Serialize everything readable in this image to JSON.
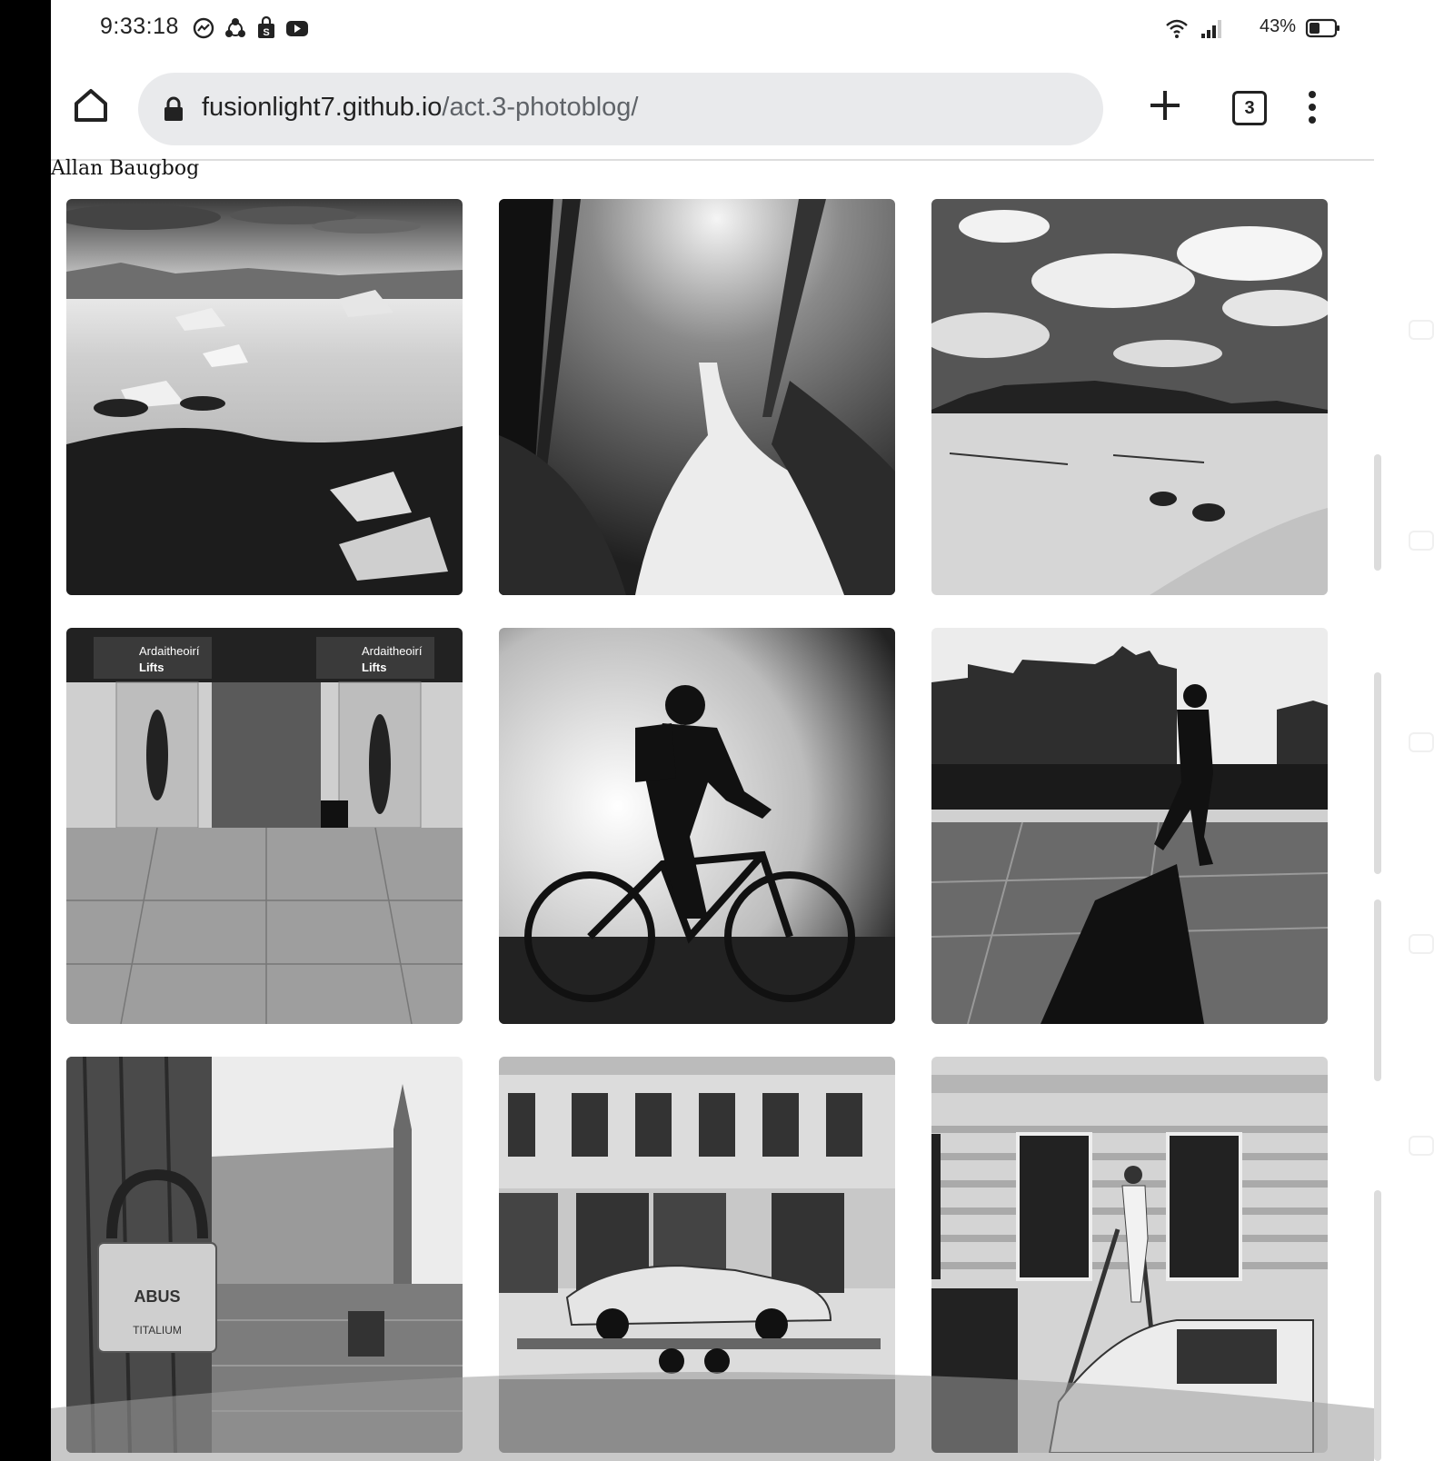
{
  "status_bar": {
    "time": "9:33:18",
    "notification_icons": [
      "messenger-icon",
      "sync-icon",
      "shop-bag-icon",
      "youtube-icon"
    ],
    "system_icons": [
      "wifi-icon",
      "signal-icon",
      "battery-icon"
    ],
    "battery_percent": "43%",
    "battery_level": 0.43
  },
  "browser": {
    "url_domain": "fusionlight7.github.io",
    "url_path": "/act.3-photoblog/",
    "tab_count": "3",
    "buttons": [
      "home-icon",
      "lock-icon",
      "plus-icon",
      "tabs-icon",
      "more-vert-icon"
    ]
  },
  "page": {
    "author": "Allan Baugbog",
    "photos": [
      "icebergs-lagoon",
      "forest-waterfall",
      "desert-clouds",
      "airport-lifts",
      "cyclist-silhouette",
      "walking-man-harbour",
      "padlock-townhall",
      "car-trailer",
      "ladder-worker"
    ]
  },
  "colors": {
    "url_bar_bg": "#e9eaec",
    "text": "#222222",
    "url_path": "#5f6368",
    "page_bg": "#ffffff"
  }
}
